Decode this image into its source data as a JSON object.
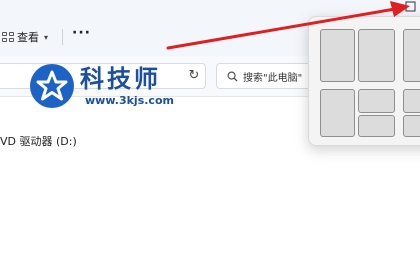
{
  "toolbar": {
    "view_label": "查看",
    "more_label": "···"
  },
  "address_bar": {
    "refresh_icon": "refresh-icon"
  },
  "search": {
    "placeholder": "搜索\"此电脑\""
  },
  "watermark": {
    "title": "科技师",
    "url": "www.3kjs.com"
  },
  "drives": [
    {
      "label": "VD 驱动器 (D:)"
    }
  ],
  "snap_layouts": {
    "layouts": [
      "two-columns",
      "grid-two-by-two"
    ]
  },
  "colors": {
    "arrow": "#e02020",
    "logo_blue": "#1d63c6",
    "toolbar_bg": "#f3f6fb"
  }
}
